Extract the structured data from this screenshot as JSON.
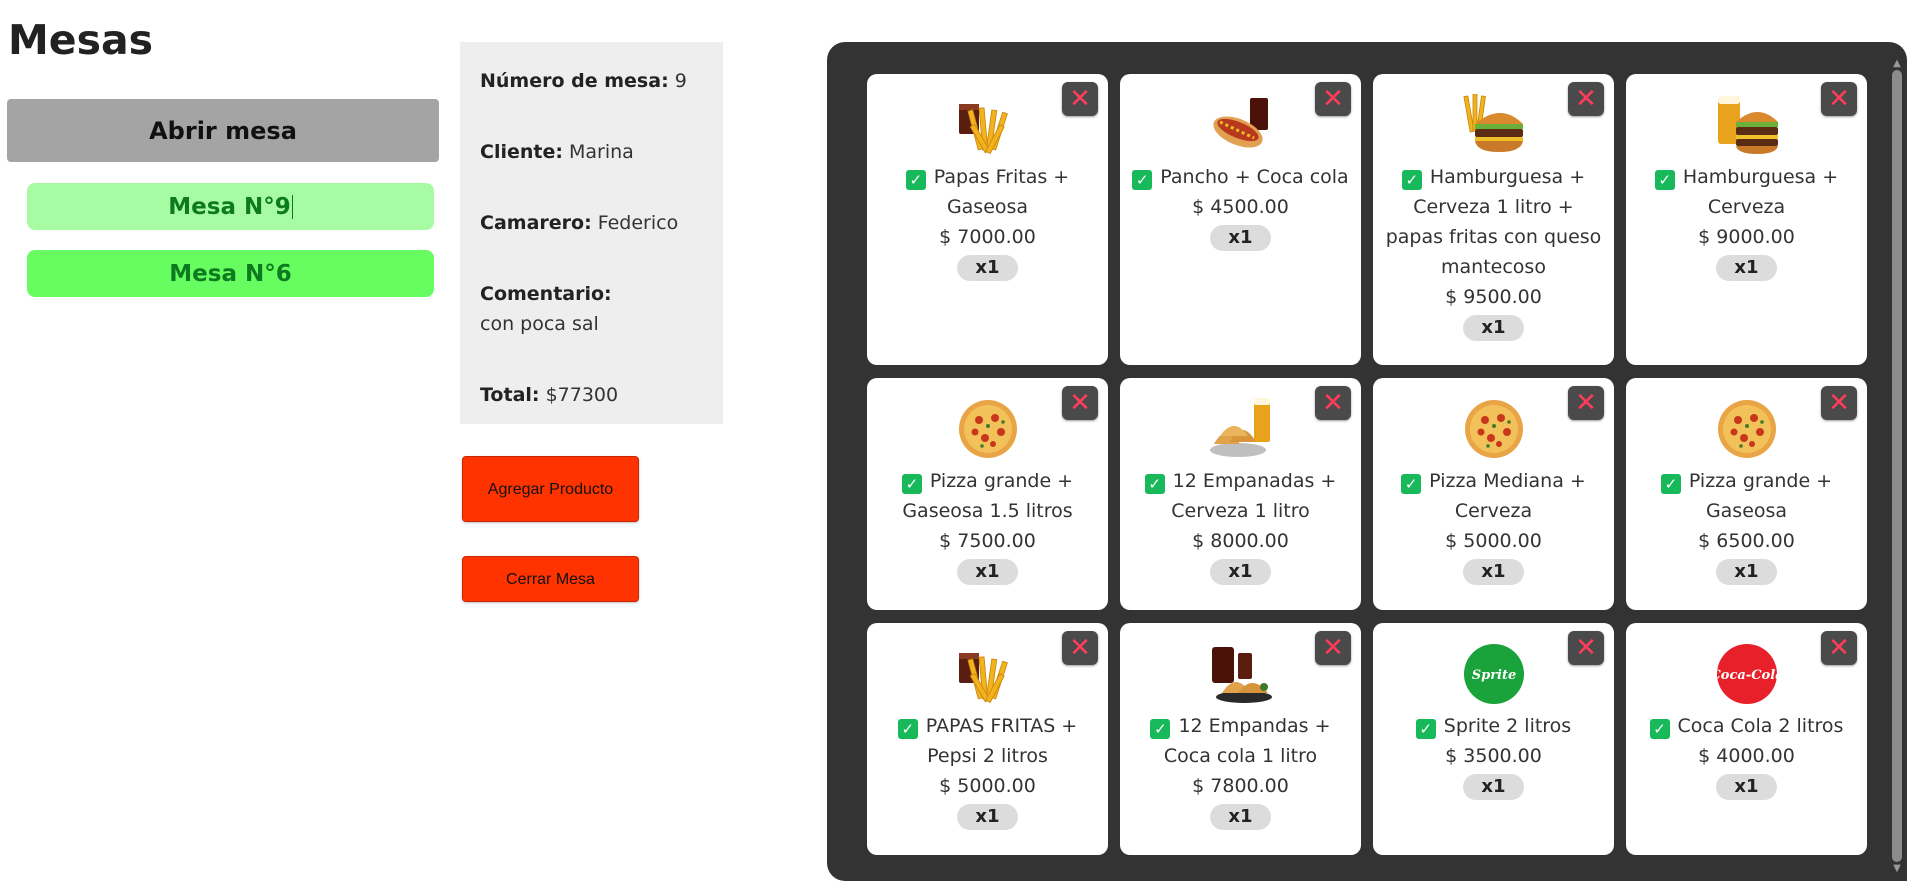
{
  "page": {
    "title": "Mesas",
    "open_button": "Abrir mesa",
    "tables": [
      "Mesa N°9",
      "Mesa N°6"
    ]
  },
  "info": {
    "table_number_label": "Número de mesa:",
    "table_number": "9",
    "client_label": "Cliente:",
    "client": "Marina",
    "waiter_label": "Camarero:",
    "waiter": "Federico",
    "comment_label": "Comentario:",
    "comment": "con poca sal",
    "total_label": "Total:",
    "total": "$77300"
  },
  "actions": {
    "add_product": "Agregar Producto",
    "close_table": "Cerrar Mesa"
  },
  "products": [
    {
      "name": "Papas Fritas + Gaseosa",
      "price": "$ 7000.00",
      "qty": "x1",
      "icon": "fries-soda"
    },
    {
      "name": "Pancho + Coca cola",
      "price": "$ 4500.00",
      "qty": "x1",
      "icon": "hotdog-soda"
    },
    {
      "name": "Hamburguesa + Cerveza 1 litro + papas fritas con queso mantecoso",
      "price": "$ 9500.00",
      "qty": "x1",
      "icon": "burger-fries"
    },
    {
      "name": "Hamburguesa + Cerveza",
      "price": "$ 9000.00",
      "qty": "x1",
      "icon": "burger-beer"
    },
    {
      "name": "Pizza grande + Gaseosa 1.5 litros",
      "price": "$ 7500.00",
      "qty": "x1",
      "icon": "pizza"
    },
    {
      "name": "12 Empanadas + Cerveza 1 litro",
      "price": "$ 8000.00",
      "qty": "x1",
      "icon": "empanadas-beer"
    },
    {
      "name": "Pizza Mediana + Cerveza",
      "price": "$ 5000.00",
      "qty": "x1",
      "icon": "pizza"
    },
    {
      "name": "Pizza grande + Gaseosa",
      "price": "$ 6500.00",
      "qty": "x1",
      "icon": "pizza"
    },
    {
      "name": "PAPAS FRITAS + Pepsi 2 litros",
      "price": "$ 5000.00",
      "qty": "x1",
      "icon": "fries-soda"
    },
    {
      "name": "12 Empandas + Coca cola 1 litro",
      "price": "$ 7800.00",
      "qty": "x1",
      "icon": "empanadas-soda"
    },
    {
      "name": "Sprite 2 litros",
      "price": "$ 3500.00",
      "qty": "x1",
      "icon": "sprite-logo",
      "logo_text": "Sprite"
    },
    {
      "name": "Coca Cola 2 litros",
      "price": "$ 4000.00",
      "qty": "x1",
      "icon": "coca-cola-logo",
      "logo_text": "Coca-Cola"
    }
  ],
  "colors": {
    "panel_bg": "#333333",
    "button_red": "#ff3300",
    "table_light": "#a7fca3",
    "table_green": "#67fc5f",
    "check_green": "#18b95a",
    "remove_x": "#ff3d5a"
  }
}
